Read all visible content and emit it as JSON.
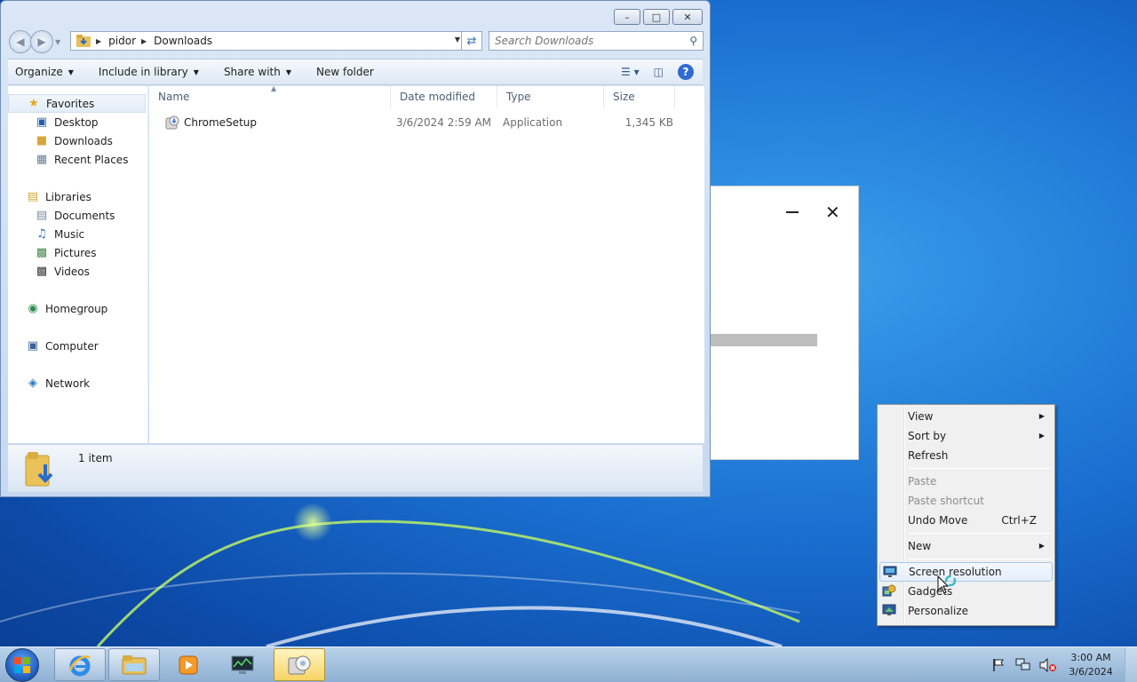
{
  "explorer": {
    "breadcrumb": [
      "pidor",
      "Downloads"
    ],
    "search_placeholder": "Search Downloads",
    "toolbar": {
      "organize": "Organize",
      "include_in_library": "Include in library",
      "share_with": "Share with",
      "new_folder": "New folder"
    },
    "nav": {
      "favorites": "Favorites",
      "favorites_items": [
        "Desktop",
        "Downloads",
        "Recent Places"
      ],
      "libraries": "Libraries",
      "libraries_items": [
        "Documents",
        "Music",
        "Pictures",
        "Videos"
      ],
      "homegroup": "Homegroup",
      "computer": "Computer",
      "network": "Network"
    },
    "columns": [
      "Name",
      "Date modified",
      "Type",
      "Size"
    ],
    "files": [
      {
        "name": "ChromeSetup",
        "date": "3/6/2024 2:59 AM",
        "type": "Application",
        "size": "1,345 KB"
      }
    ],
    "status": "1 item"
  },
  "context_menu": {
    "items": [
      {
        "label": "View",
        "submenu": true
      },
      {
        "label": "Sort by",
        "submenu": true
      },
      {
        "label": "Refresh"
      },
      {
        "label": "Paste",
        "disabled": true
      },
      {
        "label": "Paste shortcut",
        "disabled": true
      },
      {
        "label": "Undo Move",
        "shortcut": "Ctrl+Z"
      },
      {
        "label": "New",
        "submenu": true
      },
      {
        "label": "Screen resolution",
        "icon": "monitor-icon"
      },
      {
        "label": "Gadgets",
        "icon": "gadgets-icon"
      },
      {
        "label": "Personalize",
        "icon": "personalize-icon"
      }
    ]
  },
  "taskbar": {
    "time": "3:00 AM",
    "date": "3/6/2024"
  },
  "colors": {
    "accent": "#2f6bd0",
    "menu_hover_border": "#a8c8ec"
  }
}
